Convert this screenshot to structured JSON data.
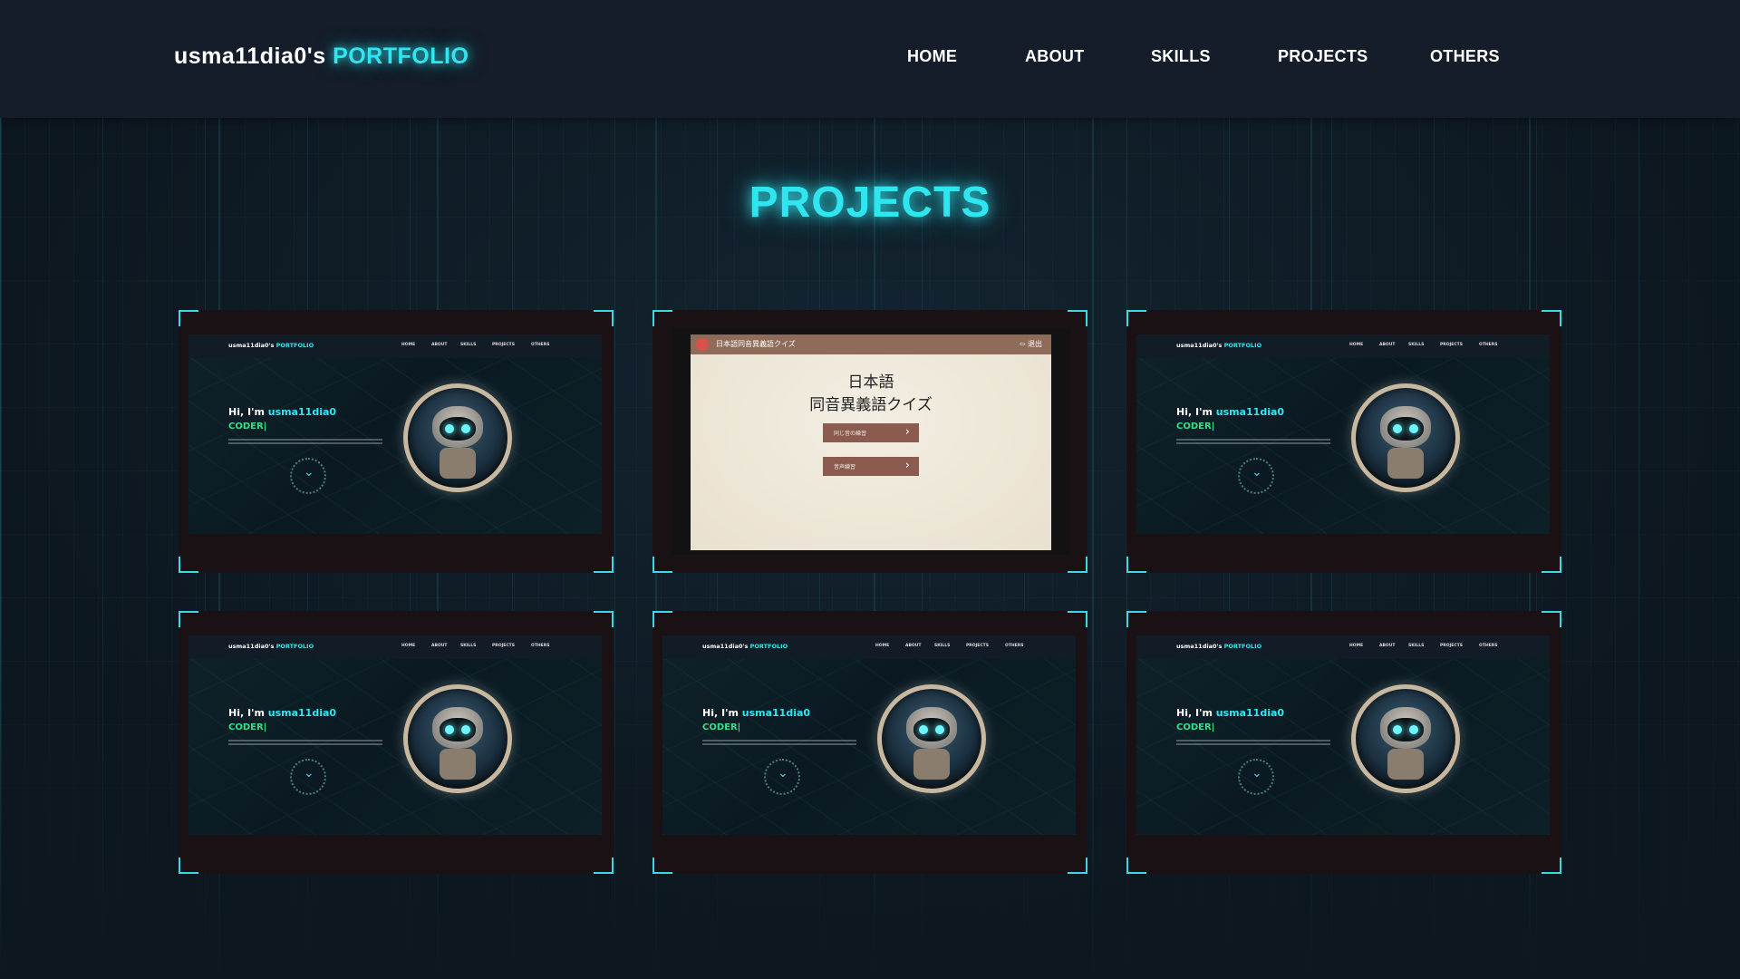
{
  "header": {
    "brand_name": "usma11dia0's",
    "brand_accent": "PORTFOLIO",
    "nav": [
      {
        "label": "HOME"
      },
      {
        "label": "ABOUT"
      },
      {
        "label": "SKILLS"
      },
      {
        "label": "PROJECTS"
      },
      {
        "label": "OTHERS"
      }
    ]
  },
  "page_title": "PROJECTS",
  "projects": [
    {
      "kind": "portfolio-preview"
    },
    {
      "kind": "quiz-preview"
    },
    {
      "kind": "portfolio-preview"
    },
    {
      "kind": "portfolio-preview"
    },
    {
      "kind": "portfolio-preview"
    },
    {
      "kind": "portfolio-preview"
    }
  ],
  "portfolio_preview": {
    "brand_name": "usma11dia0's",
    "brand_accent": "PORTFOLIO",
    "nav": [
      "HOME",
      "ABOUT",
      "SKILLS",
      "PROJECTS",
      "OTHERS"
    ],
    "greeting": "Hi, I'm",
    "name": "usma11dia0",
    "role": "CODER|"
  },
  "quiz_preview": {
    "bar_title": "日本語同音異義語クイズ",
    "exit_label": "⇦ 退出",
    "title_line1": "日本語",
    "title_line2": "同音異義語クイズ",
    "button1": "同じ音の練習",
    "button2": "音声練習"
  },
  "colors": {
    "accent": "#2fe6f0",
    "coder": "#33e08a",
    "header_bg": "#141d29",
    "page_bg": "#0d1720",
    "quiz_bar": "#8f6b5a"
  }
}
